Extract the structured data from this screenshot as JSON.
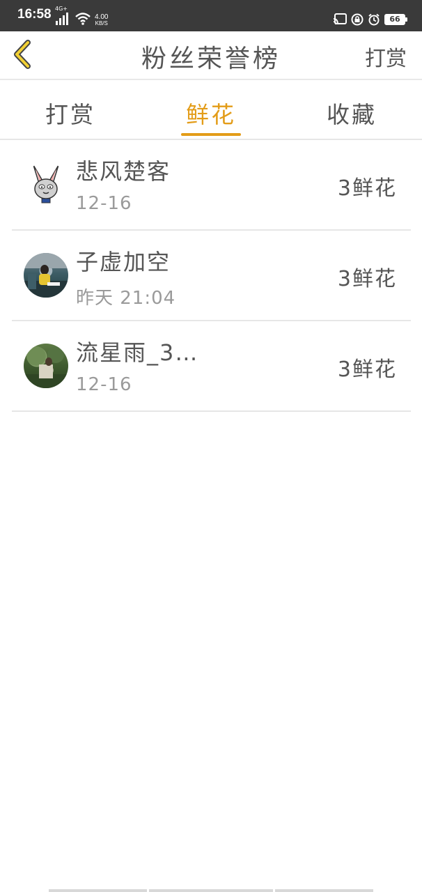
{
  "status_bar": {
    "time": "16:58",
    "network": "4G+",
    "speed_value": "4.00",
    "speed_unit": "KB/S",
    "battery": "66"
  },
  "header": {
    "title": "粉丝荣誉榜",
    "action_label": "打赏",
    "accent_color": "#e39c18"
  },
  "tabs": [
    {
      "label": "打赏",
      "active": false
    },
    {
      "label": "鲜花",
      "active": true
    },
    {
      "label": "收藏",
      "active": false
    }
  ],
  "list": [
    {
      "name": "悲风楚客",
      "time": "12-16",
      "amount": "3鲜花",
      "avatar": "rabbit-avatar"
    },
    {
      "name": "子虚加空",
      "time": "昨天 21:04",
      "amount": "3鲜花",
      "avatar": "photo-avatar"
    },
    {
      "name": "流星雨_3…",
      "time": "12-16",
      "amount": "3鲜花",
      "avatar": "photo-avatar"
    }
  ]
}
